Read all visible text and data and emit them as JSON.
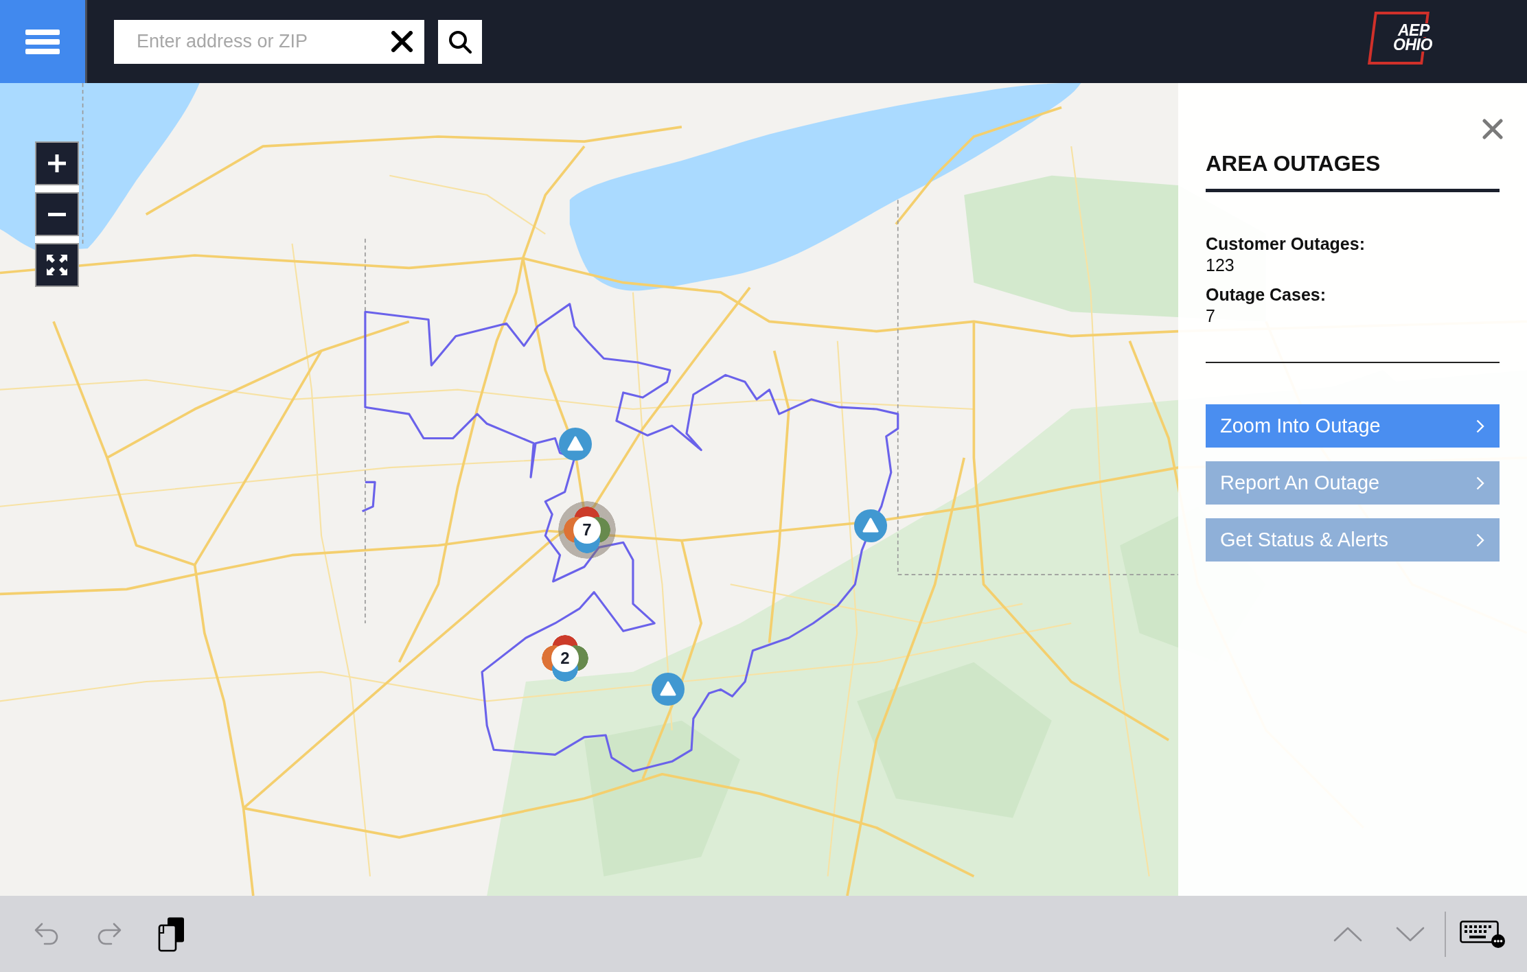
{
  "header": {
    "search": {
      "placeholder": "Enter address or ZIP"
    },
    "logo": {
      "lines": [
        "AEP",
        "OHIO"
      ]
    }
  },
  "map": {
    "markers": [
      {
        "kind": "single",
        "selected": false
      },
      {
        "kind": "cluster",
        "count": "7",
        "selected": true
      },
      {
        "kind": "single",
        "selected": false
      },
      {
        "kind": "cluster",
        "count": "2",
        "selected": false
      },
      {
        "kind": "single",
        "selected": false
      }
    ]
  },
  "panel": {
    "title": "AREA OUTAGES",
    "stats": [
      {
        "label": "Customer Outages:",
        "value": "123"
      },
      {
        "label": "Outage Cases:",
        "value": "7"
      }
    ],
    "actions": [
      {
        "label": "Zoom Into Outage",
        "kind": "primary"
      },
      {
        "label": "Report An Outage",
        "kind": "secondary"
      },
      {
        "label": "Get Status & Alerts",
        "kind": "secondary"
      }
    ]
  },
  "toolbar": {
    "left": [
      {
        "kind": "undo",
        "disabled": true
      },
      {
        "kind": "redo",
        "disabled": true
      },
      {
        "kind": "paste",
        "disabled": false
      }
    ],
    "right": [
      {
        "kind": "up",
        "disabled": true
      },
      {
        "kind": "down",
        "disabled": true
      },
      {
        "kind": "keyboard",
        "disabled": false
      }
    ]
  }
}
